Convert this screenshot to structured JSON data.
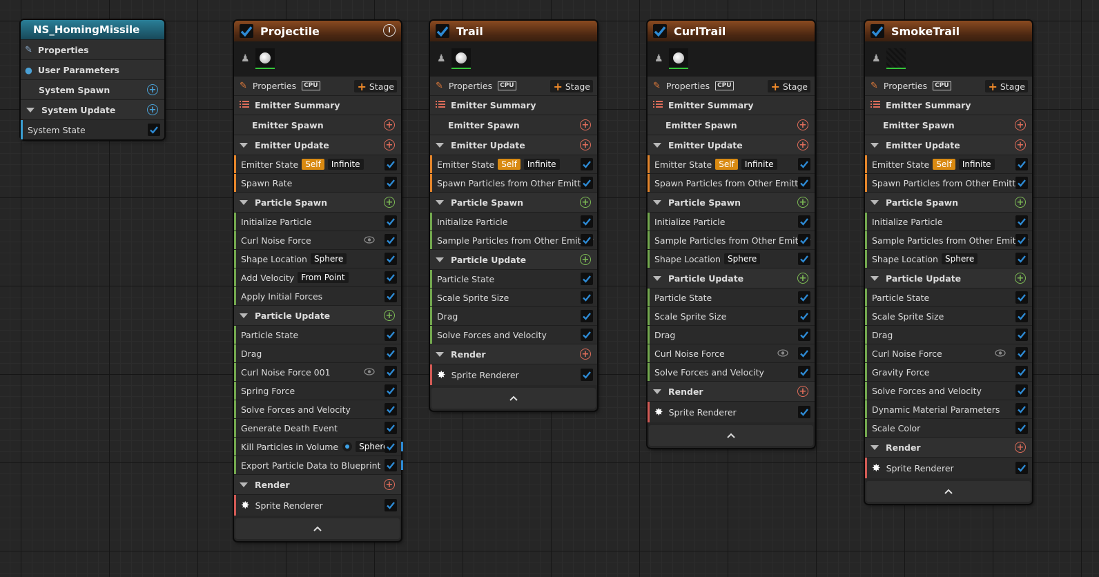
{
  "system": {
    "title": "NS_HomingMissile",
    "properties": "Properties",
    "user_parameters": "User Parameters",
    "system_spawn": "System Spawn",
    "system_update": "System Update",
    "system_state": "System State"
  },
  "common": {
    "properties": "Properties",
    "cpu": "CPU",
    "stage": "Stage",
    "emitter_summary": "Emitter Summary",
    "emitter_spawn": "Emitter Spawn",
    "emitter_update": "Emitter Update",
    "particle_spawn": "Particle Spawn",
    "particle_update": "Particle Update",
    "render": "Render",
    "sprite_renderer": "Sprite Renderer",
    "self_tag": "Self",
    "infinite_tag": "Infinite"
  },
  "emitters": [
    {
      "name": "Projectile",
      "emitter_update": [
        {
          "label": "Emitter State",
          "tags": [
            "Self",
            "Infinite"
          ]
        },
        {
          "label": "Spawn Rate"
        }
      ],
      "particle_spawn": [
        {
          "label": "Initialize Particle"
        },
        {
          "label": "Curl Noise Force",
          "eye": true
        },
        {
          "label": "Shape Location",
          "tag": "Sphere"
        },
        {
          "label": "Add Velocity",
          "tag": "From Point"
        },
        {
          "label": "Apply Initial Forces"
        }
      ],
      "particle_update": [
        {
          "label": "Particle State"
        },
        {
          "label": "Drag"
        },
        {
          "label": "Curl Noise Force 001",
          "eye": true
        },
        {
          "label": "Spring Force"
        },
        {
          "label": "Solve Forces and Velocity"
        },
        {
          "label": "Generate Death Event"
        },
        {
          "label": "Kill Particles in Volume",
          "knob": true,
          "tag": "Sphere"
        },
        {
          "label": "Export Particle Data to Blueprint",
          "knob": true
        }
      ]
    },
    {
      "name": "Trail",
      "emitter_update": [
        {
          "label": "Emitter State",
          "tags": [
            "Self",
            "Infinite"
          ]
        },
        {
          "label": "Spawn Particles from Other Emitter"
        }
      ],
      "particle_spawn": [
        {
          "label": "Initialize Particle"
        },
        {
          "label": "Sample Particles from Other Emitter"
        }
      ],
      "particle_update": [
        {
          "label": "Particle State"
        },
        {
          "label": "Scale Sprite Size"
        },
        {
          "label": "Drag"
        },
        {
          "label": "Solve Forces and Velocity"
        }
      ]
    },
    {
      "name": "CurlTrail",
      "emitter_update": [
        {
          "label": "Emitter State",
          "tags": [
            "Self",
            "Infinite"
          ]
        },
        {
          "label": "Spawn Particles from Other Emitter"
        }
      ],
      "particle_spawn": [
        {
          "label": "Initialize Particle"
        },
        {
          "label": "Sample Particles from Other Emitter"
        },
        {
          "label": "Shape Location",
          "tag": "Sphere"
        }
      ],
      "particle_update": [
        {
          "label": "Particle State"
        },
        {
          "label": "Scale Sprite Size"
        },
        {
          "label": "Drag"
        },
        {
          "label": "Curl Noise Force",
          "eye": true
        },
        {
          "label": "Solve Forces and Velocity"
        }
      ]
    },
    {
      "name": "SmokeTrail",
      "emitter_update": [
        {
          "label": "Emitter State",
          "tags": [
            "Self",
            "Infinite"
          ]
        },
        {
          "label": "Spawn Particles from Other Emitter"
        }
      ],
      "particle_spawn": [
        {
          "label": "Initialize Particle"
        },
        {
          "label": "Sample Particles from Other Emitter"
        },
        {
          "label": "Shape Location",
          "tag": "Sphere"
        }
      ],
      "particle_update": [
        {
          "label": "Particle State"
        },
        {
          "label": "Scale Sprite Size"
        },
        {
          "label": "Drag"
        },
        {
          "label": "Curl Noise Force",
          "eye": true
        },
        {
          "label": "Gravity Force"
        },
        {
          "label": "Solve Forces and Velocity"
        },
        {
          "label": "Dynamic Material Parameters"
        },
        {
          "label": "Scale Color"
        }
      ]
    }
  ],
  "colors": {
    "emitter_spawn_bar": "#e4852b",
    "emitter_update_bar": "#e4852b",
    "particle_bar": "#73a84e",
    "render_bar": "#d25a55",
    "system_bar": "#3a9dd0",
    "check": "#2d8ad4"
  }
}
